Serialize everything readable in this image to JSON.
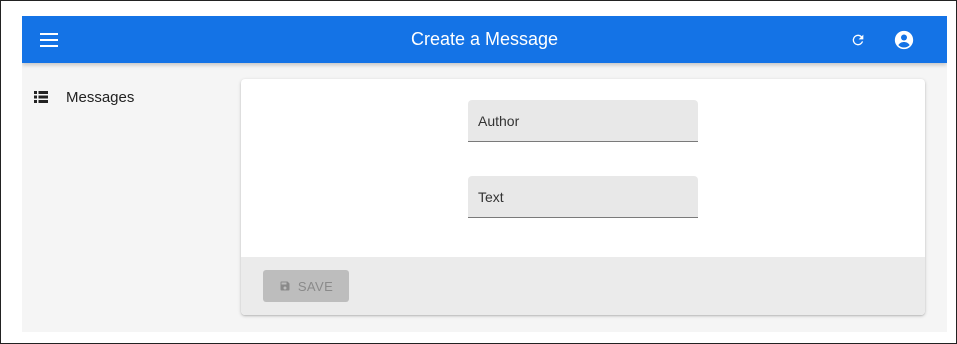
{
  "header": {
    "title": "Create a Message",
    "menu_icon": "hamburger-menu-icon",
    "refresh_icon": "refresh-icon",
    "account_icon": "account-circle-icon",
    "background_color": "#1473e6"
  },
  "sidebar": {
    "items": [
      {
        "label": "Messages",
        "icon": "list-icon"
      }
    ]
  },
  "form": {
    "fields": [
      {
        "label": "Author",
        "value": ""
      },
      {
        "label": "Text",
        "value": ""
      }
    ],
    "save_label": "SAVE",
    "save_icon": "save-icon",
    "save_disabled": true
  }
}
